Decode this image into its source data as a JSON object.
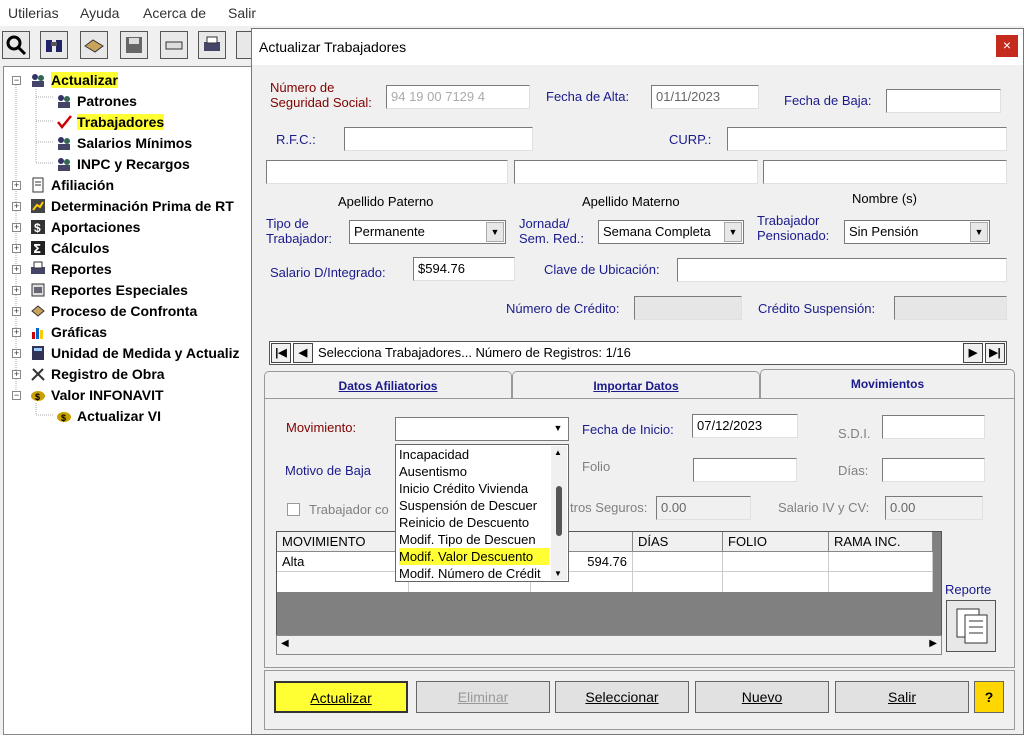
{
  "menu": [
    "Utilerias",
    "Ayuda",
    "Acerca de",
    "Salir"
  ],
  "tree": {
    "items": [
      {
        "label": "Actualizar",
        "level": 0,
        "expanded": true,
        "highlight": true,
        "icon": "people-icon"
      },
      {
        "label": "Patrones",
        "level": 1,
        "icon": "people-icon"
      },
      {
        "label": "Trabajadores",
        "level": 1,
        "highlight": true,
        "icon": "check-icon"
      },
      {
        "label": "Salarios Mínimos",
        "level": 1,
        "icon": "people-icon"
      },
      {
        "label": "INPC y Recargos",
        "level": 1,
        "icon": "people-icon"
      },
      {
        "label": "Afiliación",
        "level": 0,
        "icon": "document-icon"
      },
      {
        "label": "Determinación Prima de RT",
        "level": 0,
        "icon": "chart-icon"
      },
      {
        "label": "Aportaciones",
        "level": 0,
        "icon": "dollar-icon"
      },
      {
        "label": "Cálculos",
        "level": 0,
        "icon": "sigma-icon"
      },
      {
        "label": "Reportes",
        "level": 0,
        "icon": "printer-icon"
      },
      {
        "label": "Reportes Especiales",
        "level": 0,
        "icon": "report-icon"
      },
      {
        "label": "Proceso de Confronta",
        "level": 0,
        "icon": "compare-icon"
      },
      {
        "label": "Gráficas",
        "level": 0,
        "icon": "bar-chart-icon"
      },
      {
        "label": "Unidad de Medida y Actualiz",
        "level": 0,
        "icon": "calculator-icon"
      },
      {
        "label": "Registro de Obra",
        "level": 0,
        "icon": "tools-icon"
      },
      {
        "label": "Valor INFONAVIT",
        "level": 0,
        "expanded": true,
        "icon": "coin-icon"
      },
      {
        "label": "Actualizar VI",
        "level": 1,
        "icon": "coin-icon"
      }
    ]
  },
  "dialog": {
    "title": "Actualizar Trabajadores",
    "close": "×",
    "labels": {
      "nss": "Número de\nSeguridad Social:",
      "fecha_alta": "Fecha de Alta:",
      "fecha_baja": "Fecha de Baja:",
      "rfc": "R.F.C.:",
      "curp": "CURP.:",
      "apellido_paterno": "Apellido Paterno",
      "apellido_materno": "Apellido Materno",
      "nombres": "Nombre (s)",
      "tipo_trabajador": "Tipo de\nTrabajador:",
      "jornada": "Jornada/\nSem. Red.:",
      "pensionado": "Trabajador\nPensionado:",
      "salario": "Salario D/Integrado:",
      "clave_ubicacion": "Clave de Ubicación:",
      "numero_credito": "Número de Crédito:",
      "credito_suspension": "Crédito Suspensión:"
    },
    "values": {
      "nss": "94 19 00 7129 4",
      "fecha_alta": "01/11/2023",
      "fecha_baja": "",
      "rfc": "",
      "curp": "",
      "apellido_paterno": "",
      "apellido_materno": "",
      "nombres": "",
      "tipo_trabajador": "Permanente",
      "jornada": "Semana Completa",
      "pensionado": "Sin Pensión",
      "salario": "$594.76",
      "clave_ubicacion": "",
      "numero_credito": "",
      "credito_suspension": ""
    },
    "navigator": {
      "text": "Selecciona Trabajadores...  Número de Registros:  1/16"
    },
    "tabs": [
      "Datos Afiliatorios",
      "Importar Datos",
      "Movimientos"
    ],
    "active_tab": "Movimientos",
    "movimientos": {
      "movimiento_label": "Movimiento:",
      "movimiento_value": "",
      "fecha_inicio_label": "Fecha de Inicio:",
      "fecha_inicio_value": "07/12/2023",
      "sdi_label": "S.D.I.",
      "sdi_value": "",
      "motivo_label": "Motivo de Baja",
      "folio_label": "Folio",
      "folio_value": "",
      "dias_label": "Días:",
      "dias_value": "",
      "trabajador_chk_label": "Trabajador co",
      "otros_seguros_label": "tros Seguros:",
      "otros_seguros_value": "0.00",
      "salario_iv_label": "Salario IV y CV:",
      "salario_iv_value": "0.00",
      "dropdown_options": [
        "Incapacidad",
        "Ausentismo",
        "Inicio Crédito Vivienda",
        "Suspensión de Descuer",
        "Reinicio de Descuento",
        "Modif. Tipo de Descuen",
        "Modif. Valor Descuento",
        "Modif. Número de Crédit"
      ],
      "dropdown_highlight": "Modif. Valor Descuento",
      "grid_headers": [
        "MOVIMIENTO",
        "DÍAS",
        "FOLIO",
        "RAMA INC."
      ],
      "grid_rows": [
        [
          "Alta",
          "594.76",
          "",
          "",
          ""
        ]
      ],
      "reporte_label": "Reporte"
    },
    "buttons": {
      "actualizar": "Actualizar",
      "eliminar": "Eliminar",
      "seleccionar": "Seleccionar",
      "nuevo": "Nuevo",
      "salir": "Salir",
      "help": "?"
    }
  },
  "colors": {
    "highlight": "#ffff33",
    "label_blue": "#1a1a8c",
    "label_red": "#800000",
    "close": "#c42b1c"
  }
}
